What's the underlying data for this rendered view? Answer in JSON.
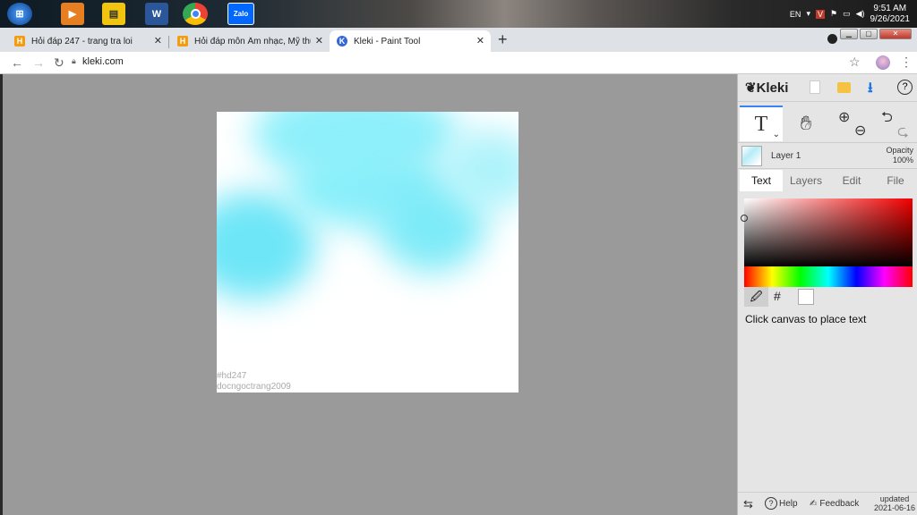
{
  "taskbar": {
    "apps": [
      "start-orb",
      "media-player",
      "file-explorer",
      "word",
      "chrome",
      "zalo"
    ],
    "zalo_label": "Zalo",
    "word_label": "W",
    "language": "EN",
    "time": "9:51 AM",
    "date": "9/26/2021"
  },
  "browser": {
    "tabs": [
      {
        "title": "Hỏi đáp 247 - trang tra loi",
        "favicon": "H"
      },
      {
        "title": "Hỏi đáp môn Âm nhạc, Mỹ thuật",
        "favicon": "H"
      },
      {
        "title": "Kleki - Paint Tool",
        "favicon": "K"
      }
    ],
    "new_tab": "+",
    "url": "kleki.com"
  },
  "canvas": {
    "watermark_line1": "#hd247",
    "watermark_line2": "docngoctrang2009"
  },
  "panel": {
    "logo": "Kleki",
    "layer_name": "Layer 1",
    "opacity_label": "Opacity",
    "opacity_value": "100%",
    "tabs": [
      "Text",
      "Layers",
      "Edit",
      "File"
    ],
    "active_tab": "Text",
    "hash": "#",
    "hint": "Click canvas to place text",
    "footer": {
      "help": "Help",
      "feedback": "Feedback",
      "updated_label": "updated",
      "updated_date": "2021-06-16"
    }
  },
  "colors": {
    "accent": "#3b82f6",
    "canvas_cyan": "#6ee6f7",
    "selected_color": "#ffffff"
  }
}
